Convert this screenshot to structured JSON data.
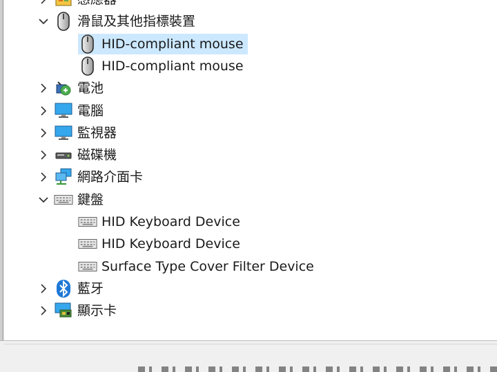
{
  "tree": {
    "items": [
      {
        "label": "感應器",
        "icon": "sensor-icon",
        "expanded": false
      },
      {
        "label": "滑鼠及其他指標裝置",
        "icon": "mouse-icon",
        "expanded": true,
        "children": [
          {
            "label": "HID-compliant mouse",
            "icon": "mouse-icon",
            "selected": true
          },
          {
            "label": "HID-compliant mouse",
            "icon": "mouse-icon"
          }
        ]
      },
      {
        "label": "電池",
        "icon": "battery-icon",
        "expanded": false
      },
      {
        "label": "電腦",
        "icon": "computer-icon",
        "expanded": false
      },
      {
        "label": "監視器",
        "icon": "monitor-icon",
        "expanded": false
      },
      {
        "label": "磁碟機",
        "icon": "disk-drive-icon",
        "expanded": false
      },
      {
        "label": "網路介面卡",
        "icon": "network-adapter-icon",
        "expanded": false
      },
      {
        "label": "鍵盤",
        "icon": "keyboard-icon",
        "expanded": true,
        "children": [
          {
            "label": "HID Keyboard Device",
            "icon": "keyboard-icon"
          },
          {
            "label": "HID Keyboard Device",
            "icon": "keyboard-icon"
          },
          {
            "label": "Surface Type Cover Filter Device",
            "icon": "keyboard-icon"
          }
        ]
      },
      {
        "label": "藍牙",
        "icon": "bluetooth-icon",
        "expanded": false
      },
      {
        "label": "顯示卡",
        "icon": "display-adapter-icon",
        "expanded": false
      }
    ]
  },
  "colors": {
    "selection": "#cce8ff",
    "status_bar": "#f0f0f0",
    "bluetooth": "#1e78d7"
  }
}
